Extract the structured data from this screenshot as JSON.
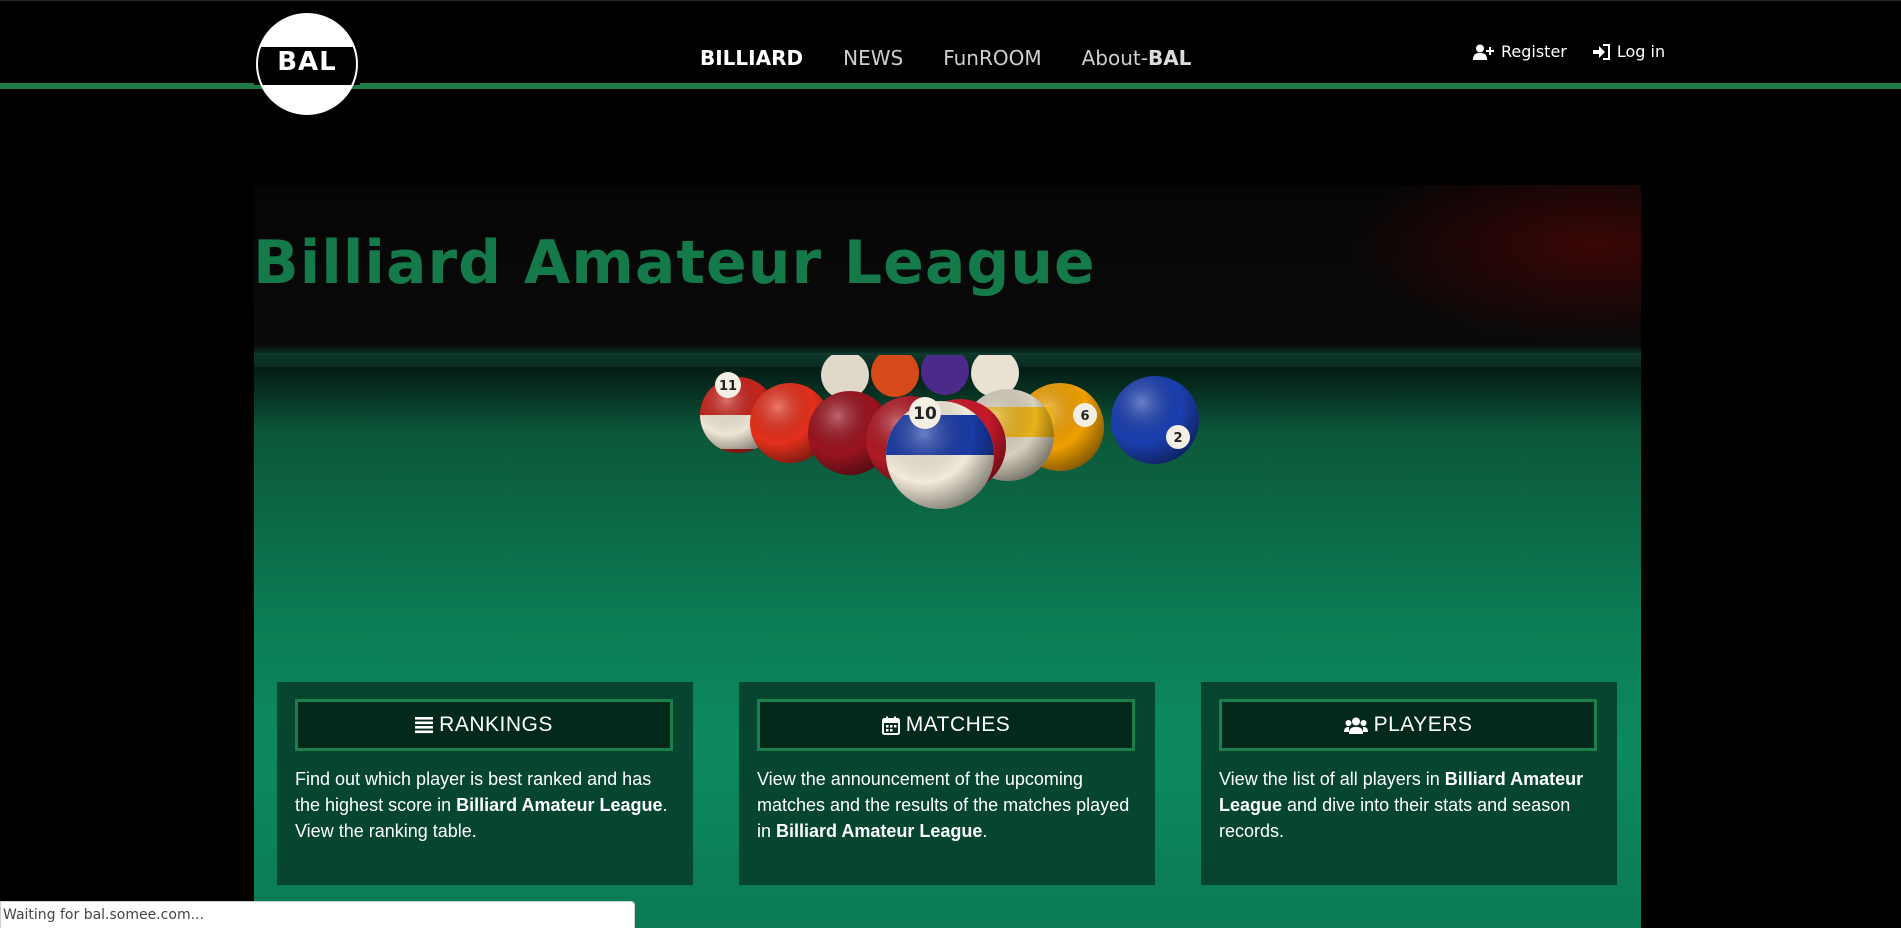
{
  "brand": {
    "logo_text": "BAL"
  },
  "nav": {
    "items": [
      {
        "label": "BILLIARD",
        "active": true
      },
      {
        "label": "NEWS",
        "active": false
      },
      {
        "label": "FunROOM",
        "active": false
      },
      {
        "label_prefix": "About-",
        "label_strong": "BAL",
        "active": false
      }
    ]
  },
  "auth": {
    "register": {
      "label": "Register",
      "icon": "user-plus-icon"
    },
    "login": {
      "label": "Log in",
      "icon": "sign-in-icon"
    }
  },
  "hero": {
    "title": "Billiard Amateur League"
  },
  "balls": [
    {
      "number": "11",
      "color": "#c8241e",
      "stripe": true
    },
    {
      "number": "10",
      "color": "#1a3aa6",
      "stripe": true
    },
    {
      "number": "6",
      "color": "#f0a000",
      "stripe": true
    },
    {
      "number": "2",
      "color": "#1b3fb0",
      "stripe": false
    }
  ],
  "cards": [
    {
      "icon": "list-icon",
      "title": "RANKINGS",
      "body": [
        {
          "text": "Find out which player is best ranked and has the highest score in "
        },
        {
          "text": "Billiard Amateur League",
          "strong": true
        },
        {
          "text": "."
        },
        {
          "text": "View the ranking table.",
          "newline": true
        }
      ]
    },
    {
      "icon": "calendar-icon",
      "title": "MATCHES",
      "body": [
        {
          "text": "View the announcement of the upcoming matches and the results of the matches played in "
        },
        {
          "text": "Billiard Amateur League",
          "strong": true
        },
        {
          "text": "."
        }
      ]
    },
    {
      "icon": "users-icon",
      "title": "PLAYERS",
      "body": [
        {
          "text": "View the list of all players in "
        },
        {
          "text": "Billiard Amateur League",
          "strong": true
        },
        {
          "text": " and dive into their stats and season records."
        }
      ]
    }
  ],
  "status_bar": {
    "text": "Waiting for bal.somee.com..."
  },
  "colors": {
    "accent_green": "#1e7a45",
    "title_green": "#157a4a",
    "card_bg": "#063c2a",
    "card_header_bg": "#03281c"
  }
}
